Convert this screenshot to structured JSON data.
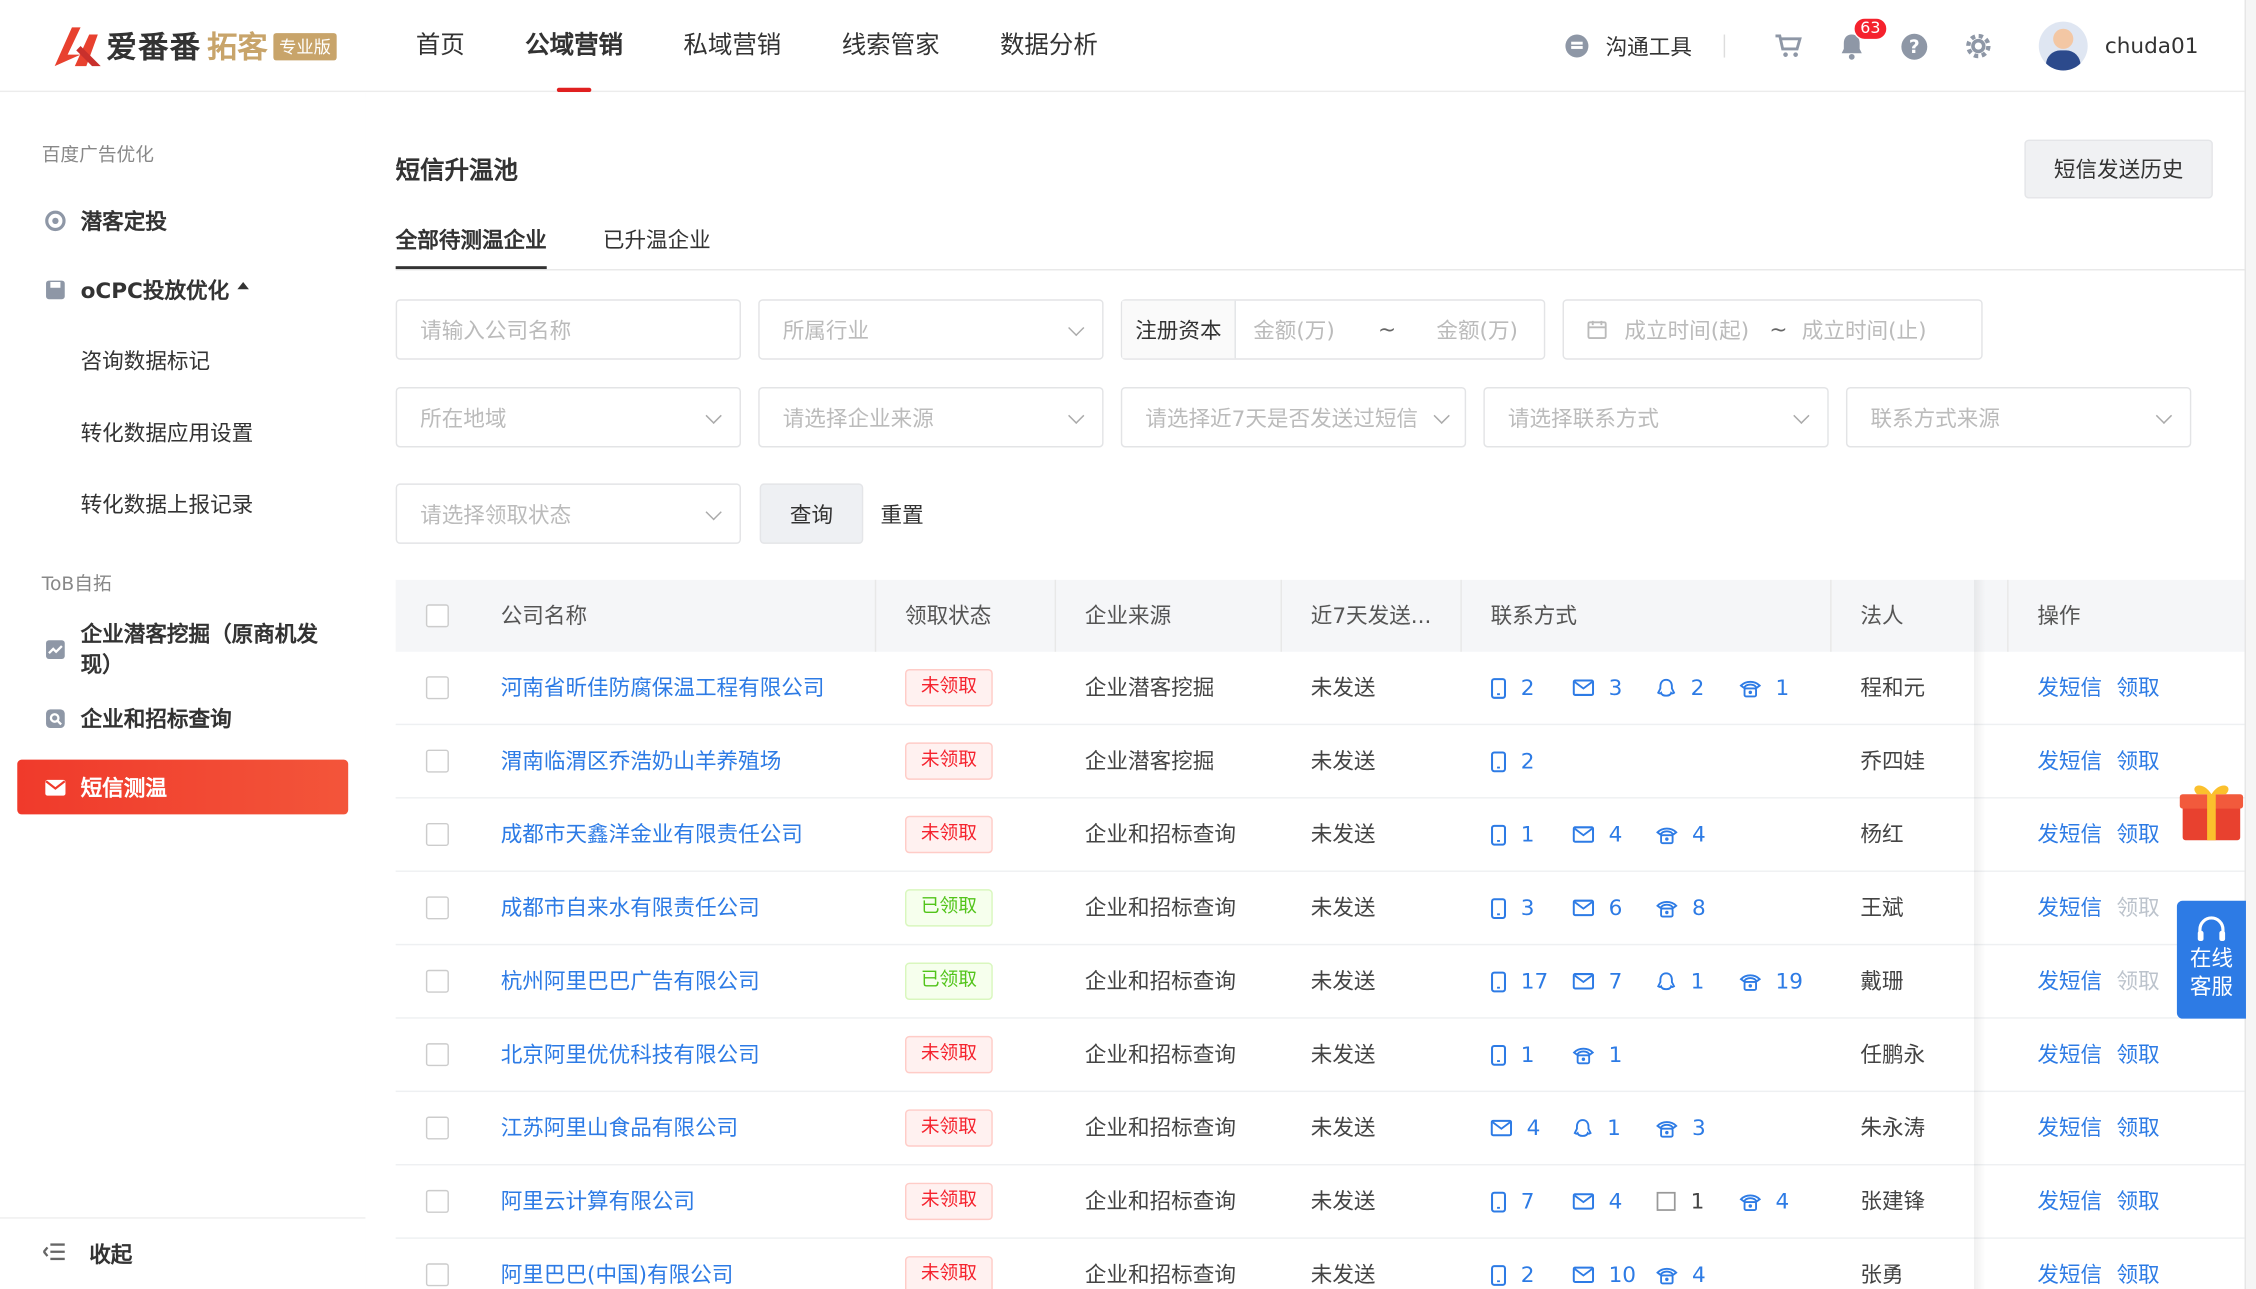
{
  "header": {
    "brand": "爱番番",
    "sub_brand": "拓客",
    "edition_badge": "专业版",
    "nav": [
      {
        "label": "首页"
      },
      {
        "label": "公域营销",
        "active": true
      },
      {
        "label": "私域营销"
      },
      {
        "label": "线索管家"
      },
      {
        "label": "数据分析"
      }
    ],
    "comm_tool": "沟通工具",
    "notification_count": "63",
    "username": "chuda01"
  },
  "sidebar": {
    "group1": "百度广告优化",
    "item_qianke": "潜客定投",
    "item_ocpc": "oCPC投放优化",
    "sub_items": [
      "咨询数据标记",
      "转化数据应用设置",
      "转化数据上报记录"
    ],
    "group2": "ToB自拓",
    "item_mining": "企业潜客挖掘（原商机发现）",
    "item_bidding": "企业和招标查询",
    "item_sms": "短信测温",
    "collapse": "收起"
  },
  "page": {
    "title": "短信升温池",
    "history_button": "短信发送历史",
    "tabs": [
      {
        "label": "全部待测温企业",
        "active": true
      },
      {
        "label": "已升温企业"
      }
    ]
  },
  "filters": {
    "company_placeholder": "请输入公司名称",
    "industry_placeholder": "所属行业",
    "capital_label": "注册资本",
    "amount_min_placeholder": "金额(万)",
    "tilde": "~",
    "amount_max_placeholder": "金额(万)",
    "date_start_placeholder": "成立时间(起)",
    "date_end_placeholder": "成立时间(止)",
    "region_placeholder": "所在地域",
    "source_placeholder": "请选择企业来源",
    "sent7_placeholder": "请选择近7天是否发送过短信",
    "contact_placeholder": "请选择联系方式",
    "contact_source_placeholder": "联系方式来源",
    "claim_placeholder": "请选择领取状态",
    "query_button": "查询",
    "reset_button": "重置"
  },
  "table": {
    "headers": [
      "公司名称",
      "领取状态",
      "企业来源",
      "近7天发送...",
      "联系方式",
      "法人",
      "操作"
    ],
    "action_sms": "发短信",
    "action_claim": "领取",
    "rows": [
      {
        "company": "河南省昕佳防腐保温工程有限公司",
        "status": "未领取",
        "claimed": false,
        "source": "企业潜客挖掘",
        "sent7": "未发送",
        "contacts": [
          {
            "type": "phone",
            "n": "2"
          },
          {
            "type": "mail",
            "n": "3"
          },
          {
            "type": "qq",
            "n": "2"
          },
          {
            "type": "tel",
            "n": "1"
          }
        ],
        "legal": "程和元"
      },
      {
        "company": "渭南临渭区乔浩奶山羊养殖场",
        "status": "未领取",
        "claimed": false,
        "source": "企业潜客挖掘",
        "sent7": "未发送",
        "contacts": [
          {
            "type": "phone",
            "n": "2"
          }
        ],
        "legal": "乔四娃"
      },
      {
        "company": "成都市天鑫洋金业有限责任公司",
        "status": "未领取",
        "claimed": false,
        "source": "企业和招标查询",
        "sent7": "未发送",
        "contacts": [
          {
            "type": "phone",
            "n": "1"
          },
          {
            "type": "mail",
            "n": "4"
          },
          {
            "type": "tel",
            "n": "4"
          }
        ],
        "legal": "杨红"
      },
      {
        "company": "成都市自来水有限责任公司",
        "status": "已领取",
        "claimed": true,
        "source": "企业和招标查询",
        "sent7": "未发送",
        "contacts": [
          {
            "type": "phone",
            "n": "3"
          },
          {
            "type": "mail",
            "n": "6"
          },
          {
            "type": "tel",
            "n": "8"
          }
        ],
        "legal": "王斌"
      },
      {
        "company": "杭州阿里巴巴广告有限公司",
        "status": "已领取",
        "claimed": true,
        "source": "企业和招标查询",
        "sent7": "未发送",
        "contacts": [
          {
            "type": "phone",
            "n": "17"
          },
          {
            "type": "mail",
            "n": "7"
          },
          {
            "type": "qq",
            "n": "1"
          },
          {
            "type": "tel",
            "n": "19"
          }
        ],
        "legal": "戴珊"
      },
      {
        "company": "北京阿里优优科技有限公司",
        "status": "未领取",
        "claimed": false,
        "source": "企业和招标查询",
        "sent7": "未发送",
        "contacts": [
          {
            "type": "phone",
            "n": "1"
          },
          {
            "type": "tel",
            "n": "1"
          }
        ],
        "legal": "任鹏永"
      },
      {
        "company": "江苏阿里山食品有限公司",
        "status": "未领取",
        "claimed": false,
        "source": "企业和招标查询",
        "sent7": "未发送",
        "contacts": [
          {
            "type": "mail",
            "n": "4"
          },
          {
            "type": "qq",
            "n": "1"
          },
          {
            "type": "tel",
            "n": "3"
          }
        ],
        "legal": "朱永涛"
      },
      {
        "company": "阿里云计算有限公司",
        "status": "未领取",
        "claimed": false,
        "source": "企业和招标查询",
        "sent7": "未发送",
        "contacts": [
          {
            "type": "phone",
            "n": "7"
          },
          {
            "type": "mail",
            "n": "4"
          },
          {
            "type": "box",
            "n": "1"
          },
          {
            "type": "tel",
            "n": "4"
          }
        ],
        "legal": "张建锋"
      },
      {
        "company": "阿里巴巴(中国)有限公司",
        "status": "未领取",
        "claimed": false,
        "source": "企业和招标查询",
        "sent7": "未发送",
        "contacts": [
          {
            "type": "phone",
            "n": "2"
          },
          {
            "type": "mail",
            "n": "10"
          },
          {
            "type": "tel",
            "n": "4"
          }
        ],
        "legal": "张勇"
      }
    ]
  },
  "float": {
    "service_line1": "在线",
    "service_line2": "客服"
  }
}
